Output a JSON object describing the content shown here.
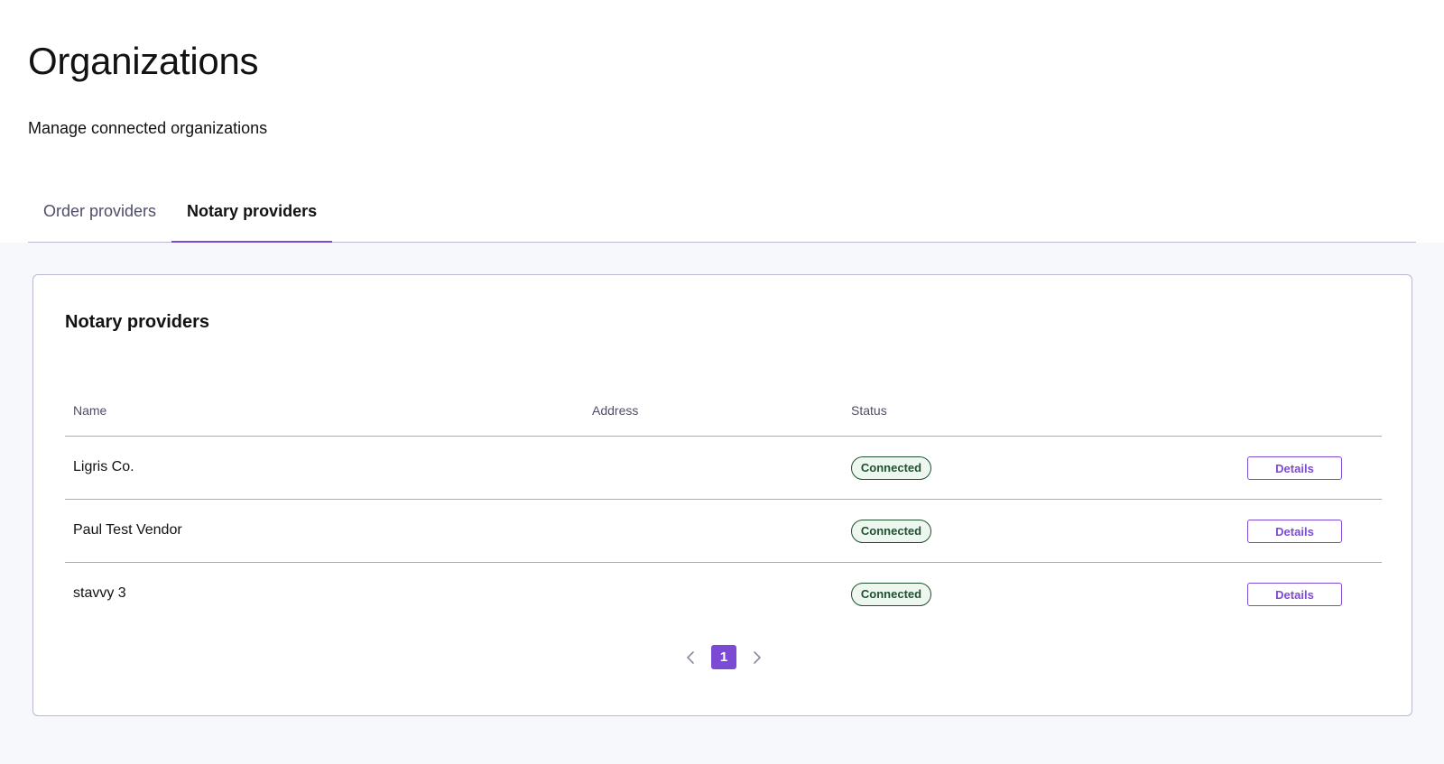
{
  "page": {
    "title": "Organizations",
    "subtitle": "Manage connected organizations"
  },
  "tabs": [
    {
      "label": "Order providers",
      "active": false
    },
    {
      "label": "Notary providers",
      "active": true
    }
  ],
  "card": {
    "title": "Notary providers",
    "columns": {
      "name": "Name",
      "address": "Address",
      "status": "Status"
    },
    "rows": [
      {
        "name": "Ligris Co.",
        "address": "",
        "status": "Connected",
        "action": "Details"
      },
      {
        "name": "Paul Test Vendor",
        "address": "",
        "status": "Connected",
        "action": "Details"
      },
      {
        "name": "stavvy 3",
        "address": "",
        "status": "Connected",
        "action": "Details"
      }
    ]
  },
  "pagination": {
    "current_page": "1",
    "prev_icon": "chevron-left-icon",
    "next_icon": "chevron-right-icon"
  },
  "colors": {
    "accent": "#7b4bd3",
    "status_connected": "#1f5130",
    "status_connected_bg": "#eef7ef",
    "main_background": "#f7f8fc"
  }
}
